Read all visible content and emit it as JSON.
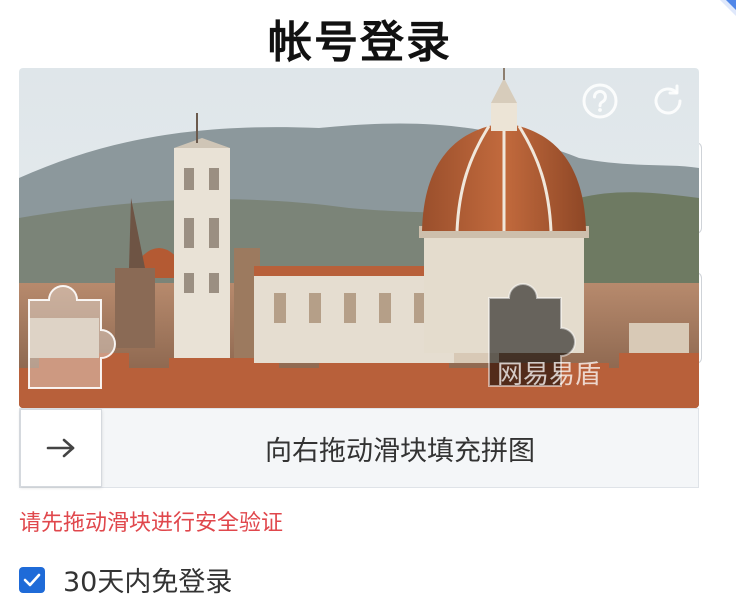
{
  "page": {
    "title": "帐号登录"
  },
  "captcha": {
    "watermark_logo": "网易易盾",
    "help_icon": "question-circle-icon",
    "refresh_icon": "refresh-icon",
    "slider_instruction": "向右拖动滑块填充拼图",
    "slider_icon": "arrow-right-icon",
    "slider_progress": 0
  },
  "validation": {
    "message": "请先拖动滑块进行安全验证",
    "color": "#e0474c"
  },
  "remember_me": {
    "label": "30天内免登录",
    "checked": true,
    "color": "#1f6bd8"
  }
}
